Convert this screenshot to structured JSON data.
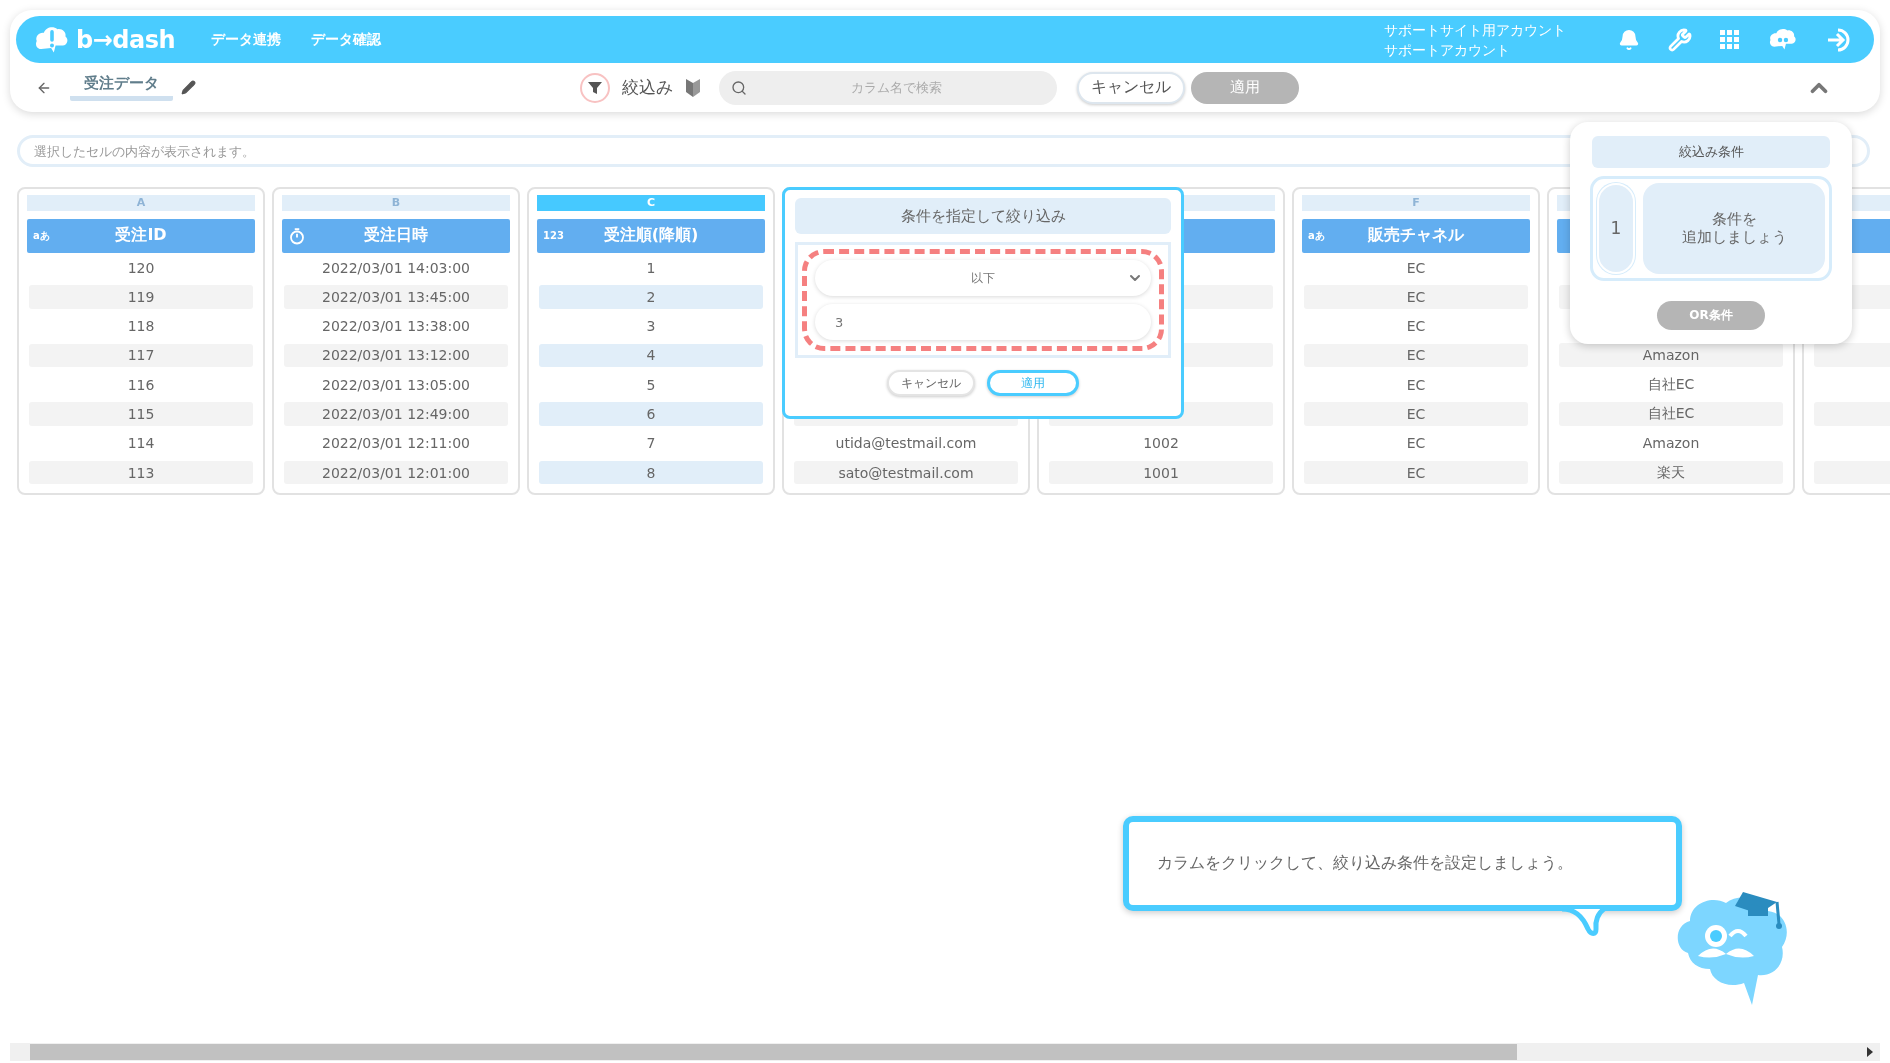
{
  "nav": {
    "logo": "b→dash",
    "menu": [
      "データ連携",
      "データ確認"
    ],
    "account": [
      "サポートサイト用アカウント",
      "サポートアカウント"
    ]
  },
  "toolbar": {
    "title": "受注データ",
    "filter_label": "絞込み",
    "search_placeholder": "カラム名で検索",
    "cancel": "キャンセル",
    "apply": "適用",
    "apply_disabled": true
  },
  "cell_viewer": {
    "placeholder": "選択したセルの内容が表示されます。"
  },
  "columns": [
    {
      "letter": "A",
      "kind": "text",
      "type_mark": "aあ",
      "title": "受注ID",
      "selected": false,
      "cells": [
        "120",
        "119",
        "118",
        "117",
        "116",
        "115",
        "114",
        "113"
      ]
    },
    {
      "letter": "B",
      "kind": "datetime",
      "title": "受注日時",
      "selected": false,
      "cells": [
        "2022/03/01 14:03:00",
        "2022/03/01 13:45:00",
        "2022/03/01 13:38:00",
        "2022/03/01 13:12:00",
        "2022/03/01 13:05:00",
        "2022/03/01 12:49:00",
        "2022/03/01 12:11:00",
        "2022/03/01 12:01:00"
      ]
    },
    {
      "letter": "C",
      "kind": "number",
      "type_mark": "123",
      "title": "受注順(降順)",
      "selected": true,
      "cells": [
        "1",
        "2",
        "3",
        "4",
        "5",
        "6",
        "7",
        "8"
      ]
    },
    {
      "selected": false,
      "cells": [
        null,
        null,
        null,
        null,
        null,
        null,
        "utida@testmail.com",
        "sato@testmail.com"
      ]
    },
    {
      "selected": false,
      "cells": [
        null,
        null,
        null,
        null,
        null,
        null,
        "1002",
        "1001"
      ]
    },
    {
      "letter": "F",
      "kind": "text",
      "type_mark": "aあ",
      "title": "販売チャネル",
      "selected": false,
      "cells": [
        "EC",
        "EC",
        "EC",
        "EC",
        "EC",
        "EC",
        "EC",
        "EC"
      ]
    },
    {
      "selected": false,
      "cells": [
        null,
        null,
        null,
        "Amazon",
        "自社EC",
        "自社EC",
        "Amazon",
        "楽天"
      ]
    },
    {
      "selected": false,
      "cells": [
        null,
        null,
        null,
        null,
        null,
        null,
        null,
        null
      ]
    }
  ],
  "filter_popup": {
    "title": "条件を指定して絞り込み",
    "operator": "以下",
    "value": "3",
    "cancel": "キャンセル",
    "apply": "適用"
  },
  "conditions_panel": {
    "title": "絞込み条件",
    "groups": [
      {
        "number": "1",
        "lines": [
          "条件を",
          "追加しましょう"
        ]
      }
    ],
    "or_button": "OR条件",
    "or_disabled": true
  },
  "hint": {
    "text": "カラムをクリックして、絞り込み条件を設定しましょう。"
  }
}
